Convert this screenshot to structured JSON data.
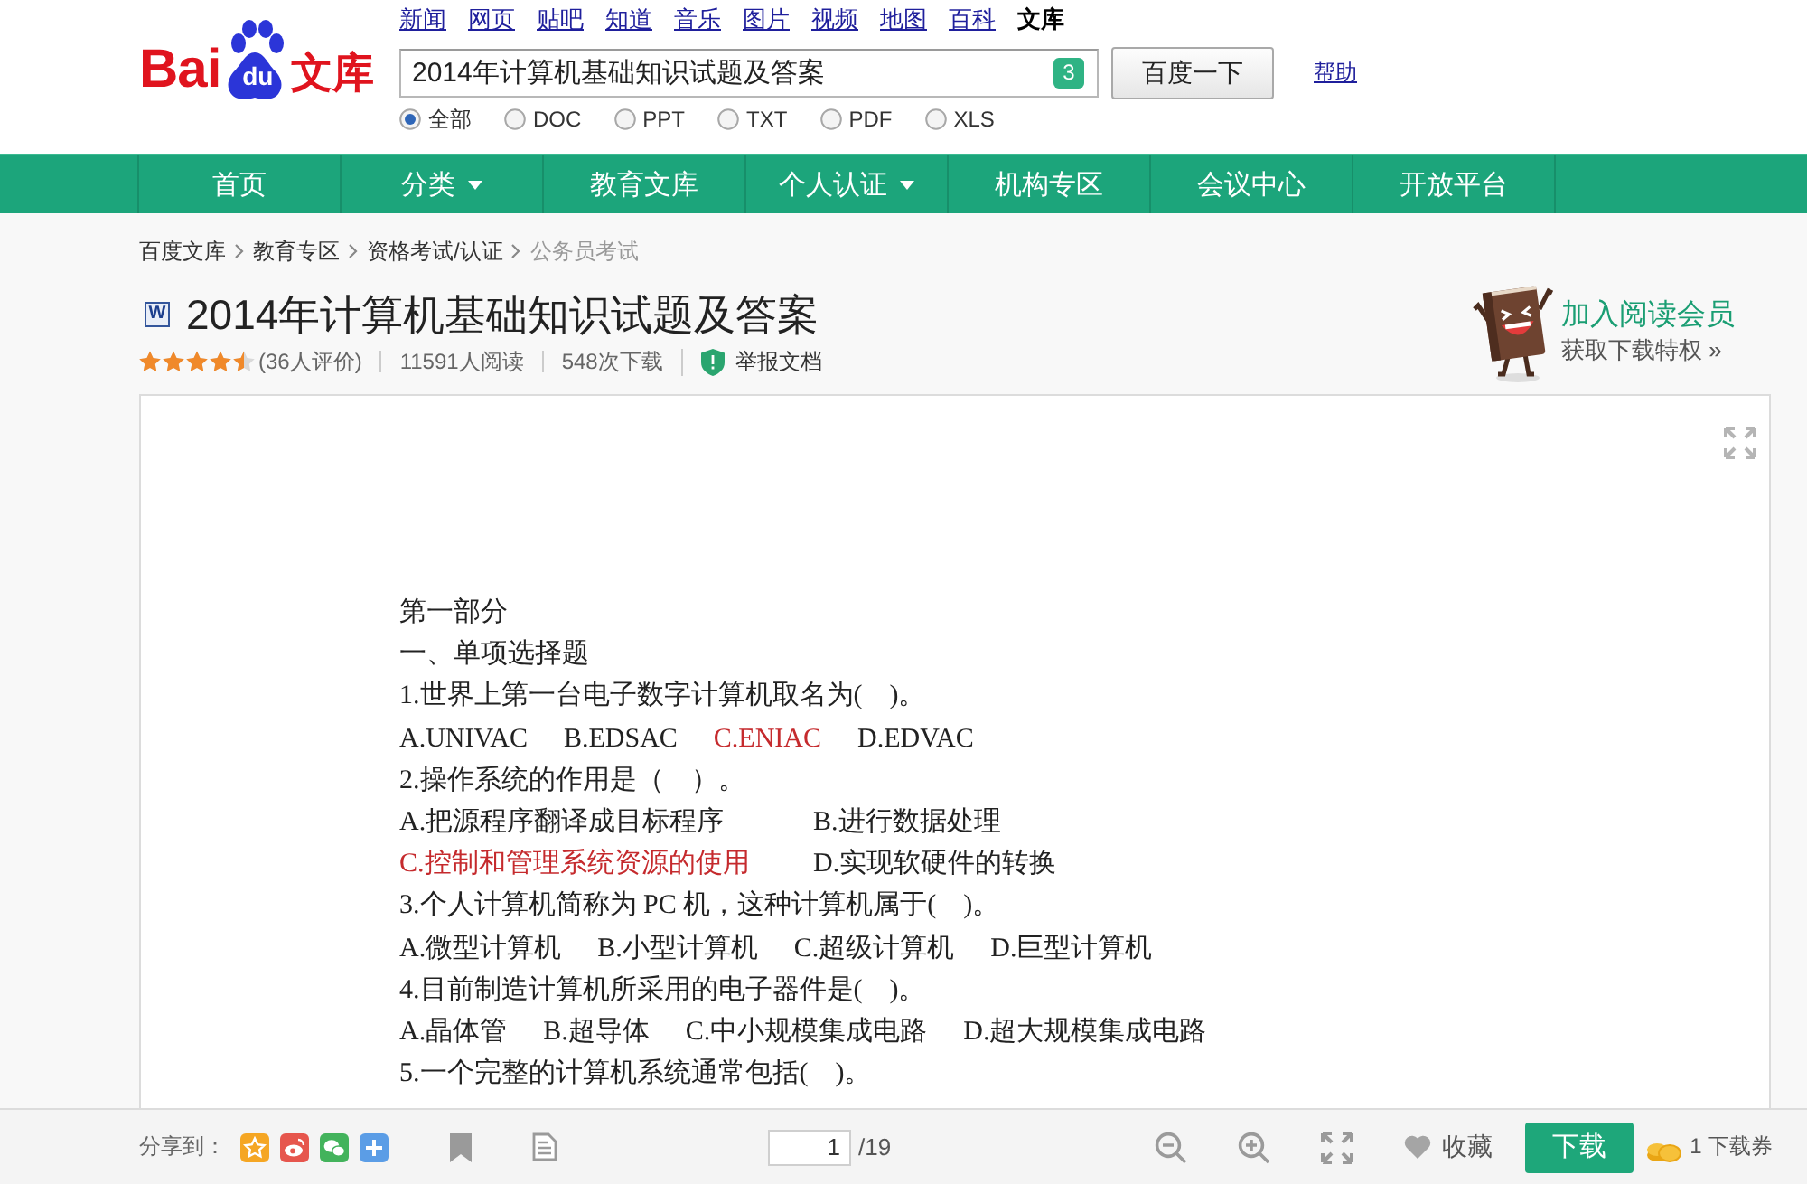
{
  "top_links": [
    {
      "label": "新闻",
      "selected": false
    },
    {
      "label": "网页",
      "selected": false
    },
    {
      "label": "贴吧",
      "selected": false
    },
    {
      "label": "知道",
      "selected": false
    },
    {
      "label": "音乐",
      "selected": false
    },
    {
      "label": "图片",
      "selected": false
    },
    {
      "label": "视频",
      "selected": false
    },
    {
      "label": "地图",
      "selected": false
    },
    {
      "label": "百科",
      "selected": false
    },
    {
      "label": "文库",
      "selected": true
    }
  ],
  "logo": {
    "left": "Bai",
    "paw": "du",
    "right": "文库"
  },
  "search": {
    "value": "2014年计算机基础知识试题及答案",
    "count": "3",
    "button": "百度一下",
    "help": "帮助"
  },
  "file_types": [
    {
      "label": "全部",
      "selected": true
    },
    {
      "label": "DOC",
      "selected": false
    },
    {
      "label": "PPT",
      "selected": false
    },
    {
      "label": "TXT",
      "selected": false
    },
    {
      "label": "PDF",
      "selected": false
    },
    {
      "label": "XLS",
      "selected": false
    }
  ],
  "nav": [
    {
      "label": "首页",
      "dropdown": false
    },
    {
      "label": "分类",
      "dropdown": true
    },
    {
      "label": "教育文库",
      "dropdown": false
    },
    {
      "label": "个人认证",
      "dropdown": true
    },
    {
      "label": "机构专区",
      "dropdown": false
    },
    {
      "label": "会议中心",
      "dropdown": false
    },
    {
      "label": "开放平台",
      "dropdown": false
    }
  ],
  "breadcrumb": [
    {
      "label": "百度文库",
      "current": false
    },
    {
      "label": "教育专区",
      "current": false
    },
    {
      "label": "资格考试/认证",
      "current": false
    },
    {
      "label": "公务员考试",
      "current": true
    }
  ],
  "document": {
    "file_type": "W",
    "title": "2014年计算机基础知识试题及答案",
    "stars": 4.5,
    "ratings": "(36人评价)",
    "reads": "11591人阅读",
    "downloads": "548次下载",
    "report": "举报文档"
  },
  "promo": {
    "title": "加入阅读会员",
    "link": "获取下载特权 »"
  },
  "viewer": {
    "lines": [
      {
        "kind": "heading",
        "text": "第一部分"
      },
      {
        "kind": "heading",
        "text": "一、单项选择题"
      },
      {
        "kind": "question",
        "text": "1.世界上第一台电子数字计算机取名为(    )。"
      },
      {
        "kind": "options",
        "options": [
          {
            "text": "A.UNIVAC",
            "correct": false
          },
          {
            "text": "B.EDSAC",
            "correct": false
          },
          {
            "text": "C.ENIAC",
            "correct": true
          },
          {
            "text": "D.EDVAC",
            "correct": false
          }
        ]
      },
      {
        "kind": "question",
        "text": "2.操作系统的作用是（    ）。"
      },
      {
        "kind": "options",
        "options": [
          {
            "text": "A.把源程序翻译成目标程序",
            "correct": false
          },
          {
            "text": "B.进行数据处理",
            "correct": false
          }
        ]
      },
      {
        "kind": "options",
        "options": [
          {
            "text": "C.控制和管理系统资源的使用",
            "correct": true
          },
          {
            "text": "D.实现软硬件的转换",
            "correct": false
          }
        ]
      },
      {
        "kind": "question",
        "text": "3.个人计算机简称为 PC 机，这种计算机属于(    )。"
      },
      {
        "kind": "options",
        "options": [
          {
            "text": "A.微型计算机",
            "correct": false
          },
          {
            "text": "B.小型计算机",
            "correct": false
          },
          {
            "text": "C.超级计算机",
            "correct": false
          },
          {
            "text": "D.巨型计算机",
            "correct": false
          }
        ]
      },
      {
        "kind": "question",
        "text": "4.目前制造计算机所采用的电子器件是(    )。"
      },
      {
        "kind": "options",
        "options": [
          {
            "text": "A.晶体管",
            "correct": false
          },
          {
            "text": "B.超导体",
            "correct": false
          },
          {
            "text": "C.中小规模集成电路",
            "correct": false
          },
          {
            "text": "D.超大规模集成电路",
            "correct": false
          }
        ]
      },
      {
        "kind": "question",
        "text": "5.一个完整的计算机系统通常包括(    )。"
      }
    ]
  },
  "toolbar": {
    "share_label": "分享到：",
    "page": "1",
    "page_total": "/19",
    "favorite": "收藏",
    "download": "下载",
    "coupons": "1 下载券"
  }
}
